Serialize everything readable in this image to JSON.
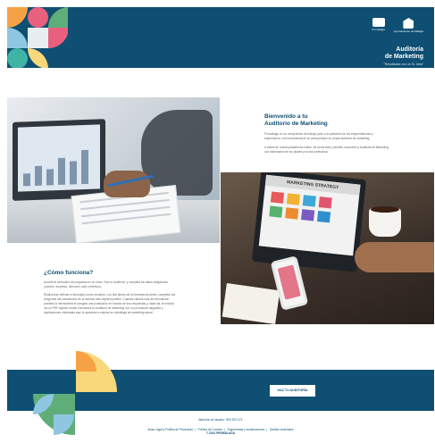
{
  "header": {
    "brand_title_line1": "Auditoría",
    "brand_title_line2": "de Marketing",
    "brand_tagline": "\"Resultados con un Sí. Idea\"",
    "logos": [
      {
        "name": "Promálaga",
        "icon": "malaga-logo-icon"
      },
      {
        "name": "Ayuntamiento de Málaga",
        "icon": "city-hall-logo-icon"
      }
    ]
  },
  "colors": {
    "primary": "#0e4f73",
    "pink": "#e9607e",
    "orange": "#f6a244",
    "yellow": "#f8d87a",
    "green": "#5fae7a",
    "light_blue": "#8fc7e2",
    "teal": "#3fb3a5"
  },
  "intro": {
    "title_line1": "Bienvenido a tu",
    "title_line2": "Auditorio de Marketing",
    "paragraph1": "Promálaga, en su compromiso de trabajo junto a la población de los emprendedores y empresarios, une herramienta de su para predecir su propia auditoria de marketing.",
    "paragraph2": "A través de nuestra plataforma online, de forma fácil y sencilla, descubre tu Auditoria de Marketing con información de los pilares y hucha profesional."
  },
  "how": {
    "title": "¿Cómo funciona?",
    "paragraph1": "Accede al formulario de preguntas en un único \"Haz tu Auditoría\" y completa los datos obligatorios (nombre, empresa, dirección, web y teléfono).",
    "paragraph2": "Realiza tras rellenar el formulario como recuadro. Los test dentro de la herramienta deben completar las preguntas del cuestionario de la síntesis más objetiva posible. Cuantos valores más de información posibles la herramienta le otorgará una puntuación en función de sus respuestas y, dada las, le enviará vía un PDF adjunto donde encontrará su Auditoría de Marketing con un puntuación asignada y explicaciones orientadas aquí le ayudarán a mejorar su estrategia de marketing actual."
  },
  "footer": {
    "cta_label": "HAZ TU AUDITORÍA",
    "contact": "Atención al usuario: 952 202 071",
    "legal_links": [
      "Aviso Legal y Política de Privacidad",
      "Política de Cookies",
      "Sugerencias y reclamaciones",
      "Gestión solicitudes"
    ],
    "copyright": "© 2021 PROMÁLAGA"
  },
  "images": {
    "office": "photo-office-desk-analysis",
    "strategy": "photo-marketing-strategy-laptop",
    "strategy_screen_label": "MARKETING STRATEGY"
  }
}
